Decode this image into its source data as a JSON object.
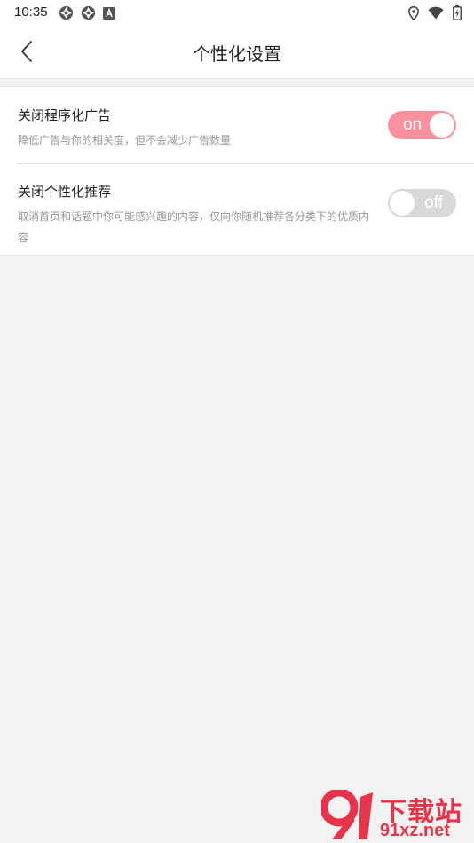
{
  "status_bar": {
    "time": "10:35",
    "left_icons": [
      "aperture-icon",
      "aperture-icon",
      "app-a-icon"
    ],
    "right_icons": [
      "location-icon",
      "wifi-icon",
      "battery-icon"
    ]
  },
  "header": {
    "back_icon": "chevron-left-icon",
    "title": "个性化设置"
  },
  "settings": [
    {
      "title": "关闭程序化广告",
      "description": "降低广告与你的相关度，但不会减少广告数量",
      "toggle_state": "on",
      "toggle_label": "on"
    },
    {
      "title": "关闭个性化推荐",
      "description": "取消首页和话题中你可能感兴趣的内容，仅向你随机推荐各分类下的优质内容",
      "toggle_state": "off",
      "toggle_label": "off"
    }
  ],
  "watermark": {
    "logo_text": "91",
    "title": "下载站",
    "domain": "91xz.net"
  },
  "colors": {
    "toggle_on": "#f7919e",
    "toggle_off": "#d9d9d9",
    "background": "#f2f2f2",
    "watermark": "#e8344a"
  }
}
